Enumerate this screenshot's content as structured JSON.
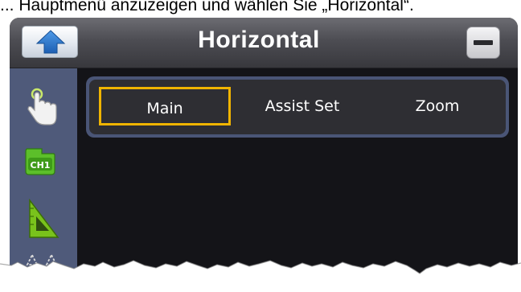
{
  "caption": "... Hauptmenü anzuzeigen und wählen Sie „Horizontal“.",
  "window": {
    "title": "Horizontal"
  },
  "titlebar": {
    "back_icon": "up-arrow-icon",
    "minimize_icon": "minimize-icon"
  },
  "sidebar": {
    "items": [
      {
        "icon": "touch-hand-icon"
      },
      {
        "icon": "ch1-channel-icon",
        "label": "CH1"
      },
      {
        "icon": "ruler-triangle-icon"
      },
      {
        "icon": "cursor-marker-icon"
      }
    ]
  },
  "tabs": [
    {
      "label": "Main",
      "active": true
    },
    {
      "label": "Assist Set",
      "active": false
    },
    {
      "label": "Zoom",
      "active": false
    }
  ],
  "colors": {
    "accent": "#f0b400",
    "titlebar": "#4d4d53",
    "sidebar": "#4f5a7a",
    "panel": "#141418",
    "tab_bar": "#2e2e33",
    "ch1_green": "#5cbf2a"
  }
}
